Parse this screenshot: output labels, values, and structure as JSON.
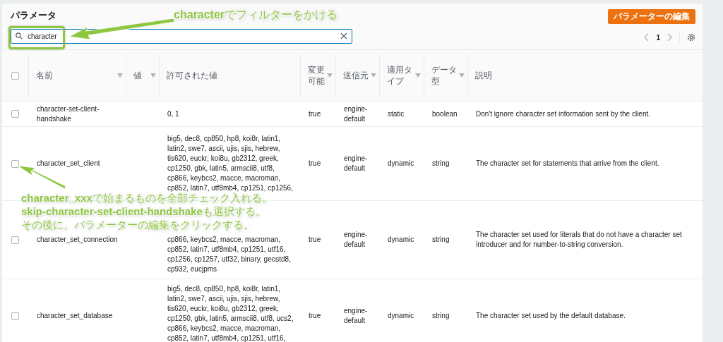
{
  "title": "パラメータ",
  "edit_button": "パラメーターの編集",
  "search": {
    "value": "character"
  },
  "pagination": {
    "page": "1"
  },
  "table": {
    "select_all_checked": false,
    "columns": [
      {
        "label": "名前",
        "sortable": true
      },
      {
        "label": "値",
        "sortable": true
      },
      {
        "label": "許可された値",
        "sortable": false
      },
      {
        "label": "変更可能",
        "sortable": true
      },
      {
        "label": "送信元",
        "sortable": true
      },
      {
        "label": "適用タイプ",
        "sortable": true
      },
      {
        "label": "データ型",
        "sortable": true
      },
      {
        "label": "説明",
        "sortable": false
      }
    ],
    "rows": [
      {
        "checked": false,
        "name": "character-set-client-handshake",
        "allowed_values": [
          "0, 1"
        ],
        "modifiable": "true",
        "source": "engine-default",
        "apply_type": "static",
        "data_type": "boolean",
        "description": "Don't ignore character set information sent by the client."
      },
      {
        "checked": false,
        "name": "character_set_client",
        "allowed_values": [
          "big5, dec8, cp850, hp8, koi8r, latin1,",
          "latin2, swe7, ascii, ujis, sjis, hebrew,",
          "tis620, euckr, koi8u, gb2312, greek,",
          "cp1250, gbk, latin5, armscii8, utf8,",
          "cp866, keybcs2, macce, macroman,",
          "cp852, latin7, utf8mb4, cp1251, cp1256,"
        ],
        "modifiable": "true",
        "source": "engine-default",
        "apply_type": "dynamic",
        "data_type": "string",
        "description": "The character set for statements that arrive from the client."
      },
      {
        "checked": false,
        "name": "character_set_connection",
        "allowed_values": [
          "cp866, keybcs2, macce, macroman,",
          "cp852, latin7, utf8mb4, cp1251, utf16,",
          "cp1256, cp1257, utf32, binary, geostd8,",
          "cp932, eucjpms"
        ],
        "modifiable": "true",
        "source": "engine-default",
        "apply_type": "dynamic",
        "data_type": "string",
        "description": "The character set used for literals that do not have a character set introducer and for number-to-string conversion."
      },
      {
        "checked": false,
        "name": "character_set_database",
        "allowed_values": [
          "big5, dec8, cp850, hp8, koi8r, latin1,",
          "latin2, swe7, ascii, ujis, sjis, hebrew,",
          "tis620, euckr, koi8u, gb2312, greek,",
          "cp1250, gbk, latin5, armscii8, utf8, ucs2,",
          "cp866, keybcs2, macce, macroman,",
          "cp852, latin7, utf8mb4, cp1251, utf16,"
        ],
        "modifiable": "true",
        "source": "engine-default",
        "apply_type": "dynamic",
        "data_type": "string",
        "description": "The character set used by the default database."
      }
    ]
  },
  "annotations": [
    {
      "lines": [
        "**character**でフィルターをかける"
      ]
    },
    {
      "lines": [
        "**character_xxx**で始まるものを全部チェック入れる。",
        "**skip-character-set-client-handshake**も選択する。",
        "その後に、パラメーターの編集をクリックする。"
      ]
    }
  ]
}
